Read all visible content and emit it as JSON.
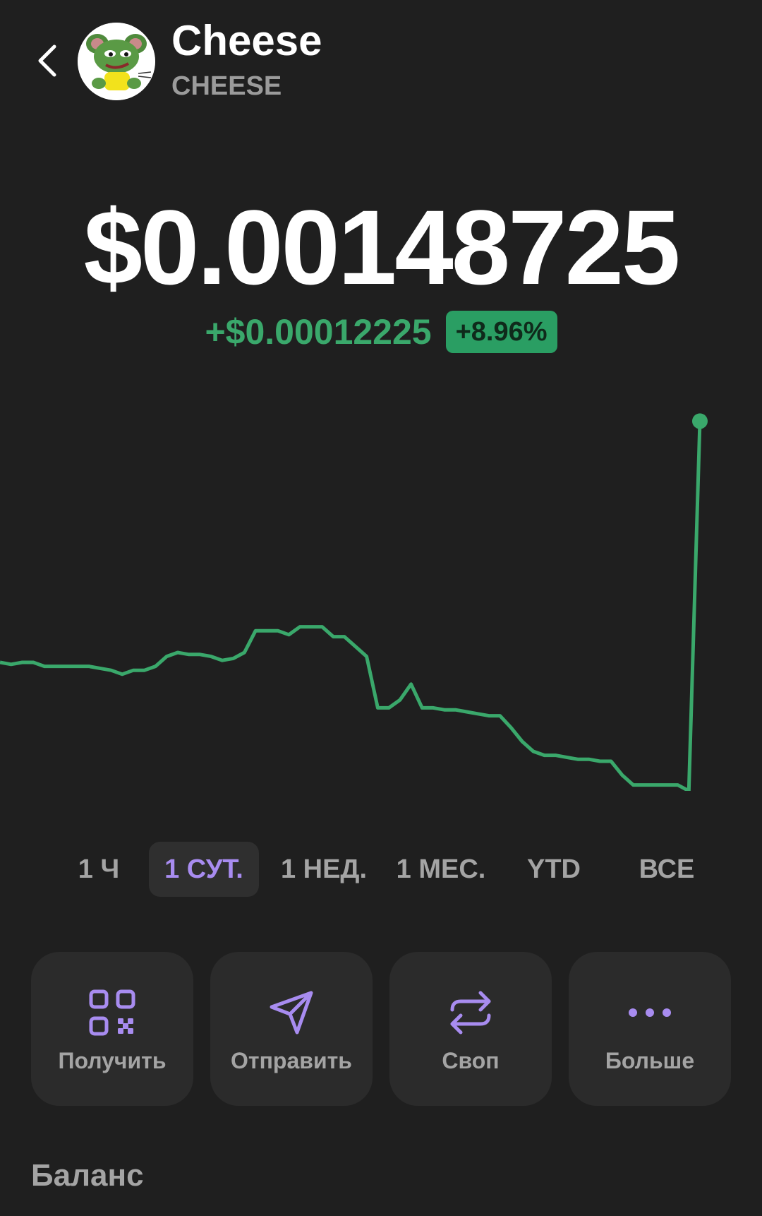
{
  "header": {
    "token_name": "Cheese",
    "token_symbol": "CHEESE"
  },
  "price": {
    "current": "$0.00148725",
    "change_abs": "+$0.00012225",
    "change_pct": "+8.96%"
  },
  "colors": {
    "up": "#3aa86b",
    "accent": "#a88cf0",
    "background": "#1f1f1f",
    "card": "#2b2b2b"
  },
  "ranges": [
    {
      "label": "1 Ч",
      "active": false
    },
    {
      "label": "1 СУТ.",
      "active": true
    },
    {
      "label": "1 НЕД.",
      "active": false
    },
    {
      "label": "1 МЕС.",
      "active": false
    },
    {
      "label": "YTD",
      "active": false
    },
    {
      "label": "ВСЕ",
      "active": false
    }
  ],
  "actions": [
    {
      "label": "Получить",
      "icon": "qr-code-icon"
    },
    {
      "label": "Отправить",
      "icon": "send-icon"
    },
    {
      "label": "Своп",
      "icon": "swap-icon"
    },
    {
      "label": "Больше",
      "icon": "more-icon"
    }
  ],
  "balance": {
    "title": "Баланс"
  },
  "chart_data": {
    "type": "line",
    "title": "",
    "xlabel": "",
    "ylabel": "",
    "grid": false,
    "legend": "none",
    "y_unit": "USD",
    "ylim": [
      0.0013,
      0.0015
    ],
    "series": [
      {
        "values": [
          0.001365,
          0.001364,
          0.001365,
          0.001365,
          0.001363,
          0.001363,
          0.001363,
          0.001363,
          0.001363,
          0.001362,
          0.001361,
          0.001359,
          0.001361,
          0.001361,
          0.001363,
          0.001368,
          0.00137,
          0.001369,
          0.001369,
          0.001368,
          0.001366,
          0.001367,
          0.00137,
          0.001381,
          0.001381,
          0.001381,
          0.001379,
          0.001383,
          0.001383,
          0.001383,
          0.001378,
          0.001378,
          0.001373,
          0.001368,
          0.001342,
          0.001342,
          0.001346,
          0.001354,
          0.001342,
          0.001342,
          0.001341,
          0.001341,
          0.00134,
          0.001339,
          0.001338,
          0.001338,
          0.001332,
          0.001325,
          0.00132,
          0.001318,
          0.001318,
          0.001317,
          0.001316,
          0.001316,
          0.001315,
          0.001315,
          0.001308,
          0.001303,
          0.001303,
          0.001303,
          0.001303,
          0.001303,
          0.0013,
          0.001487
        ]
      }
    ]
  }
}
